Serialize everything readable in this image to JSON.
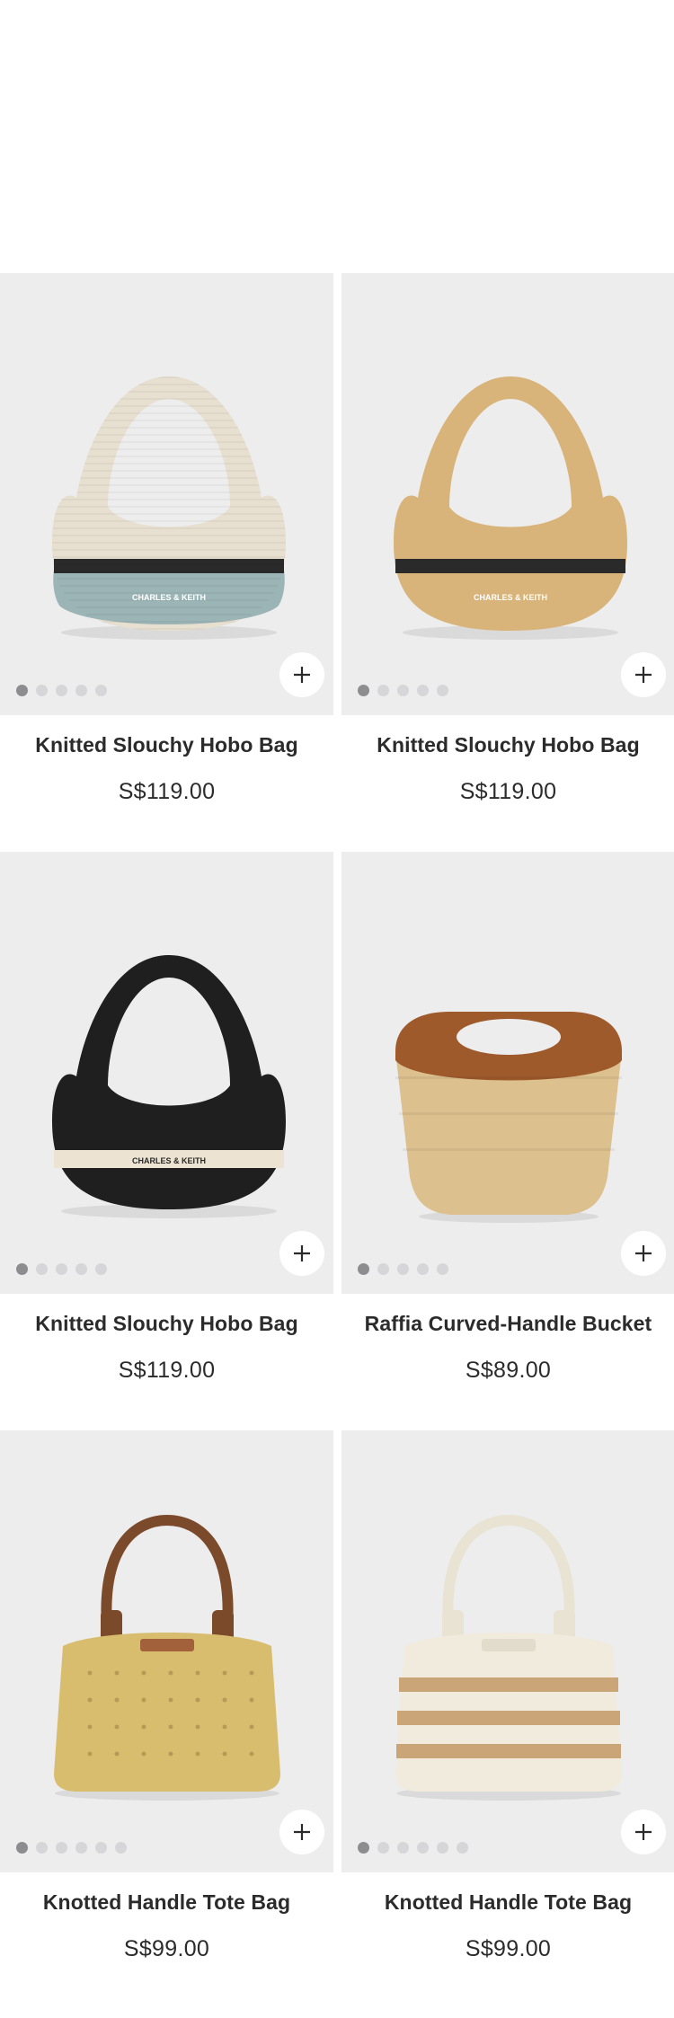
{
  "colors": {
    "image_bg": "#ededee",
    "dot_active": "#8d8d90",
    "dot_inactive": "#d6d6d8",
    "text": "#2b2b2b"
  },
  "products": [
    {
      "name": "Knitted Slouchy Hobo Bag",
      "price": "S$119.00",
      "dots": 5,
      "bag_style": "hobo-cream-blue",
      "brand_mark": "CHARLES & KEITH"
    },
    {
      "name": "Knitted Slouchy Hobo Bag",
      "price": "S$119.00",
      "dots": 5,
      "bag_style": "hobo-tan",
      "brand_mark": "CHARLES & KEITH"
    },
    {
      "name": "Knitted Slouchy Hobo Bag",
      "price": "S$119.00",
      "dots": 5,
      "bag_style": "hobo-black",
      "brand_mark": "CHARLES & KEITH"
    },
    {
      "name": "Raffia Curved-Handle Bucket",
      "price": "S$89.00",
      "dots": 5,
      "bag_style": "bucket-raffia"
    },
    {
      "name": "Knotted Handle Tote Bag",
      "price": "S$99.00",
      "dots": 6,
      "bag_style": "tote-yellow"
    },
    {
      "name": "Knotted Handle Tote Bag",
      "price": "S$99.00",
      "dots": 6,
      "bag_style": "tote-cream-stripe"
    }
  ],
  "icons": {
    "add": "plus-icon"
  }
}
